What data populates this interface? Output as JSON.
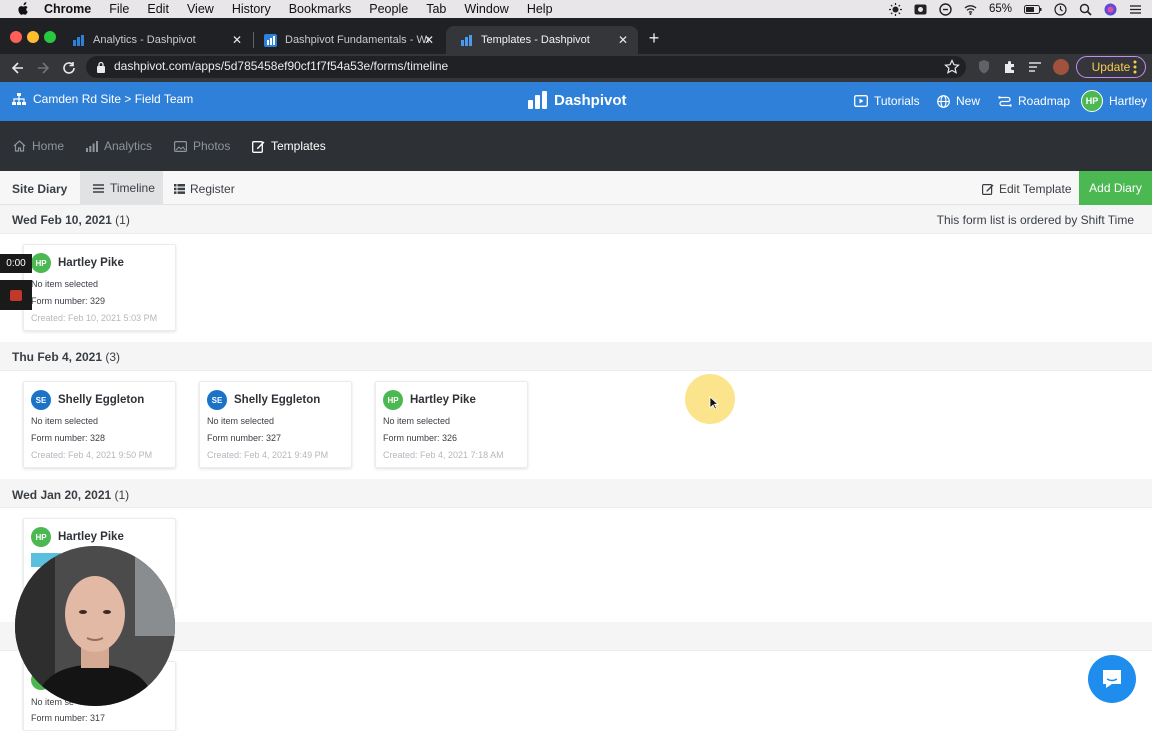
{
  "menubar": {
    "items": [
      "Chrome",
      "File",
      "Edit",
      "View",
      "History",
      "Bookmarks",
      "People",
      "Tab",
      "Window",
      "Help"
    ],
    "battery": "65%"
  },
  "browser": {
    "tabs": [
      {
        "title": "Analytics - Dashpivot"
      },
      {
        "title": "Dashpivot Fundamentals - We"
      },
      {
        "title": "Templates - Dashpivot"
      }
    ],
    "url": "dashpivot.com/apps/5d785458ef90cf1f7f54a53e/forms/timeline",
    "update_label": "Update"
  },
  "header": {
    "breadcrumb": "Camden Rd Site > Field Team",
    "brand": "Dashpivot",
    "links": {
      "tutorials": "Tutorials",
      "new": "New",
      "roadmap": "Roadmap",
      "user": "Hartley",
      "user_initials": "HP"
    }
  },
  "nav": {
    "home": "Home",
    "analytics": "Analytics",
    "photos": "Photos",
    "templates": "Templates"
  },
  "subbar": {
    "title": "Site Diary",
    "timeline": "Timeline",
    "register": "Register",
    "edit_template": "Edit Template",
    "add_diary": "Add Diary"
  },
  "order_note": "This form list is ordered by Shift Time",
  "groups": [
    {
      "date": "Wed Feb 10, 2021",
      "count": "(1)",
      "cards": [
        {
          "initials": "HP",
          "name": "Hartley Pike",
          "line1": "No item selected",
          "line2": "Form number: 329",
          "line3": "Created: Feb 10, 2021 5:03 PM"
        }
      ]
    },
    {
      "date": "Thu Feb 4, 2021",
      "count": "(3)",
      "cards": [
        {
          "initials": "SE",
          "name": "Shelly Eggleton",
          "line1": "No item selected",
          "line2": "Form number: 328",
          "line3": "Created: Feb 4, 2021 9:50 PM"
        },
        {
          "initials": "SE",
          "name": "Shelly Eggleton",
          "line1": "No item selected",
          "line2": "Form number: 327",
          "line3": "Created: Feb 4, 2021 9:49 PM"
        },
        {
          "initials": "HP",
          "name": "Hartley Pike",
          "line1": "No item selected",
          "line2": "Form number: 326",
          "line3": "Created: Feb 4, 2021 7:18 AM"
        }
      ]
    },
    {
      "date": "Wed Jan 20, 2021",
      "count": "(1)",
      "cards": [
        {
          "initials": "HP",
          "name": "Hartley Pike",
          "line1": "",
          "line2": "",
          "line3": ""
        }
      ]
    }
  ],
  "partial_card": {
    "line1": "No item se",
    "line2": "Form number: 317"
  },
  "overlay": {
    "timer": "0:00"
  },
  "colors": {
    "brand_blue": "#2f80d8",
    "nav_dark": "#2d3136",
    "add_green": "#4cb852",
    "avatar_green": "#4cb852",
    "avatar_blue": "#1a73c9"
  }
}
